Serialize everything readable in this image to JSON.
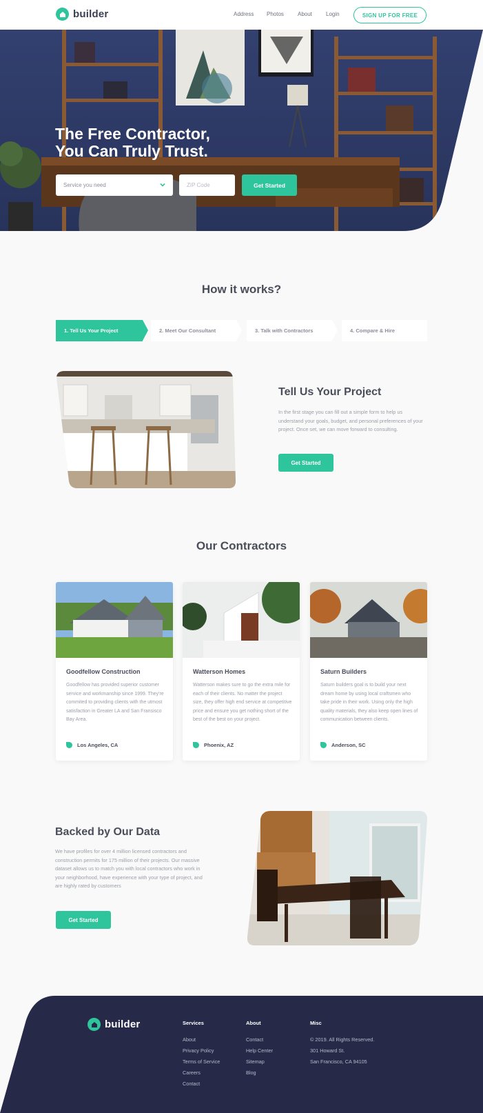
{
  "brand": {
    "name": "builder",
    "accent": "#2ec59d",
    "dark": "#262a48"
  },
  "nav": {
    "items": [
      "Address",
      "Photos",
      "About",
      "Login"
    ],
    "cta": "SIGN UP FOR FREE"
  },
  "hero": {
    "title_line1": "The Free Contractor,",
    "title_line2": "You Can Truly Trust.",
    "service_placeholder": "Service you need",
    "zip_placeholder": "ZIP Code",
    "cta": "Get Started"
  },
  "how": {
    "title": "How it works?",
    "steps": [
      "1. Tell Us Your Project",
      "2. Meet Our Consultant",
      "3. Talk with Contractors",
      "4. Compare & Hire"
    ],
    "active_step": 0,
    "feature_title": "Tell Us Your Project",
    "feature_text": "In the first stage you can fill out a simple form to help us understand your goals, budget, and personal preferences of your project. Once set, we can move forward to consulting.",
    "cta": "Get Started"
  },
  "contractors": {
    "title": "Our Contractors",
    "cards": [
      {
        "name": "Goodfellow Construction",
        "desc": "Goodfellow has provided superior customer service and workmanship since 1999. They're commited to providing clients with the utmost satisfaction in Greater LA and San Fransisco Bay Area.",
        "location": "Los Angeles, CA"
      },
      {
        "name": "Watterson Homes",
        "desc": "Watterson makes sure to go the extra mile for each of their clients. No matter the project size, they offer high end service at competitive price and ensure you get nothing short of the best of the best on your project.",
        "location": "Phoenix, AZ"
      },
      {
        "name": "Saturn Builders",
        "desc": "Saturn builders goal is to build your next dream home by using local craftsmen who take pride in their work. Using only the high quality materials, they also keep open lines of communication between clients.",
        "location": "Anderson, SC"
      }
    ]
  },
  "data_section": {
    "title": "Backed by Our Data",
    "text": "We have profiles for over 4 million licensed contractors and construction permits for 175 million of their projects. Our massive dataset allows us to match you with local contractors who work in your neighborhood, have experience with your type of project, and are highly rated by customers",
    "cta": "Get Started"
  },
  "footer": {
    "brand": "builder",
    "columns": [
      {
        "heading": "Services",
        "links": [
          "About",
          "Privacy Policy",
          "Terms of Service",
          "Careers",
          "Contact"
        ]
      },
      {
        "heading": "About",
        "links": [
          "Contact",
          "Help Center",
          "Sitemap",
          "Blog"
        ]
      },
      {
        "heading": "Misc",
        "links": [
          "© 2019. All Rights Reserved.",
          "301 Howard St.",
          "San Francisco, CA 94105"
        ]
      }
    ]
  }
}
